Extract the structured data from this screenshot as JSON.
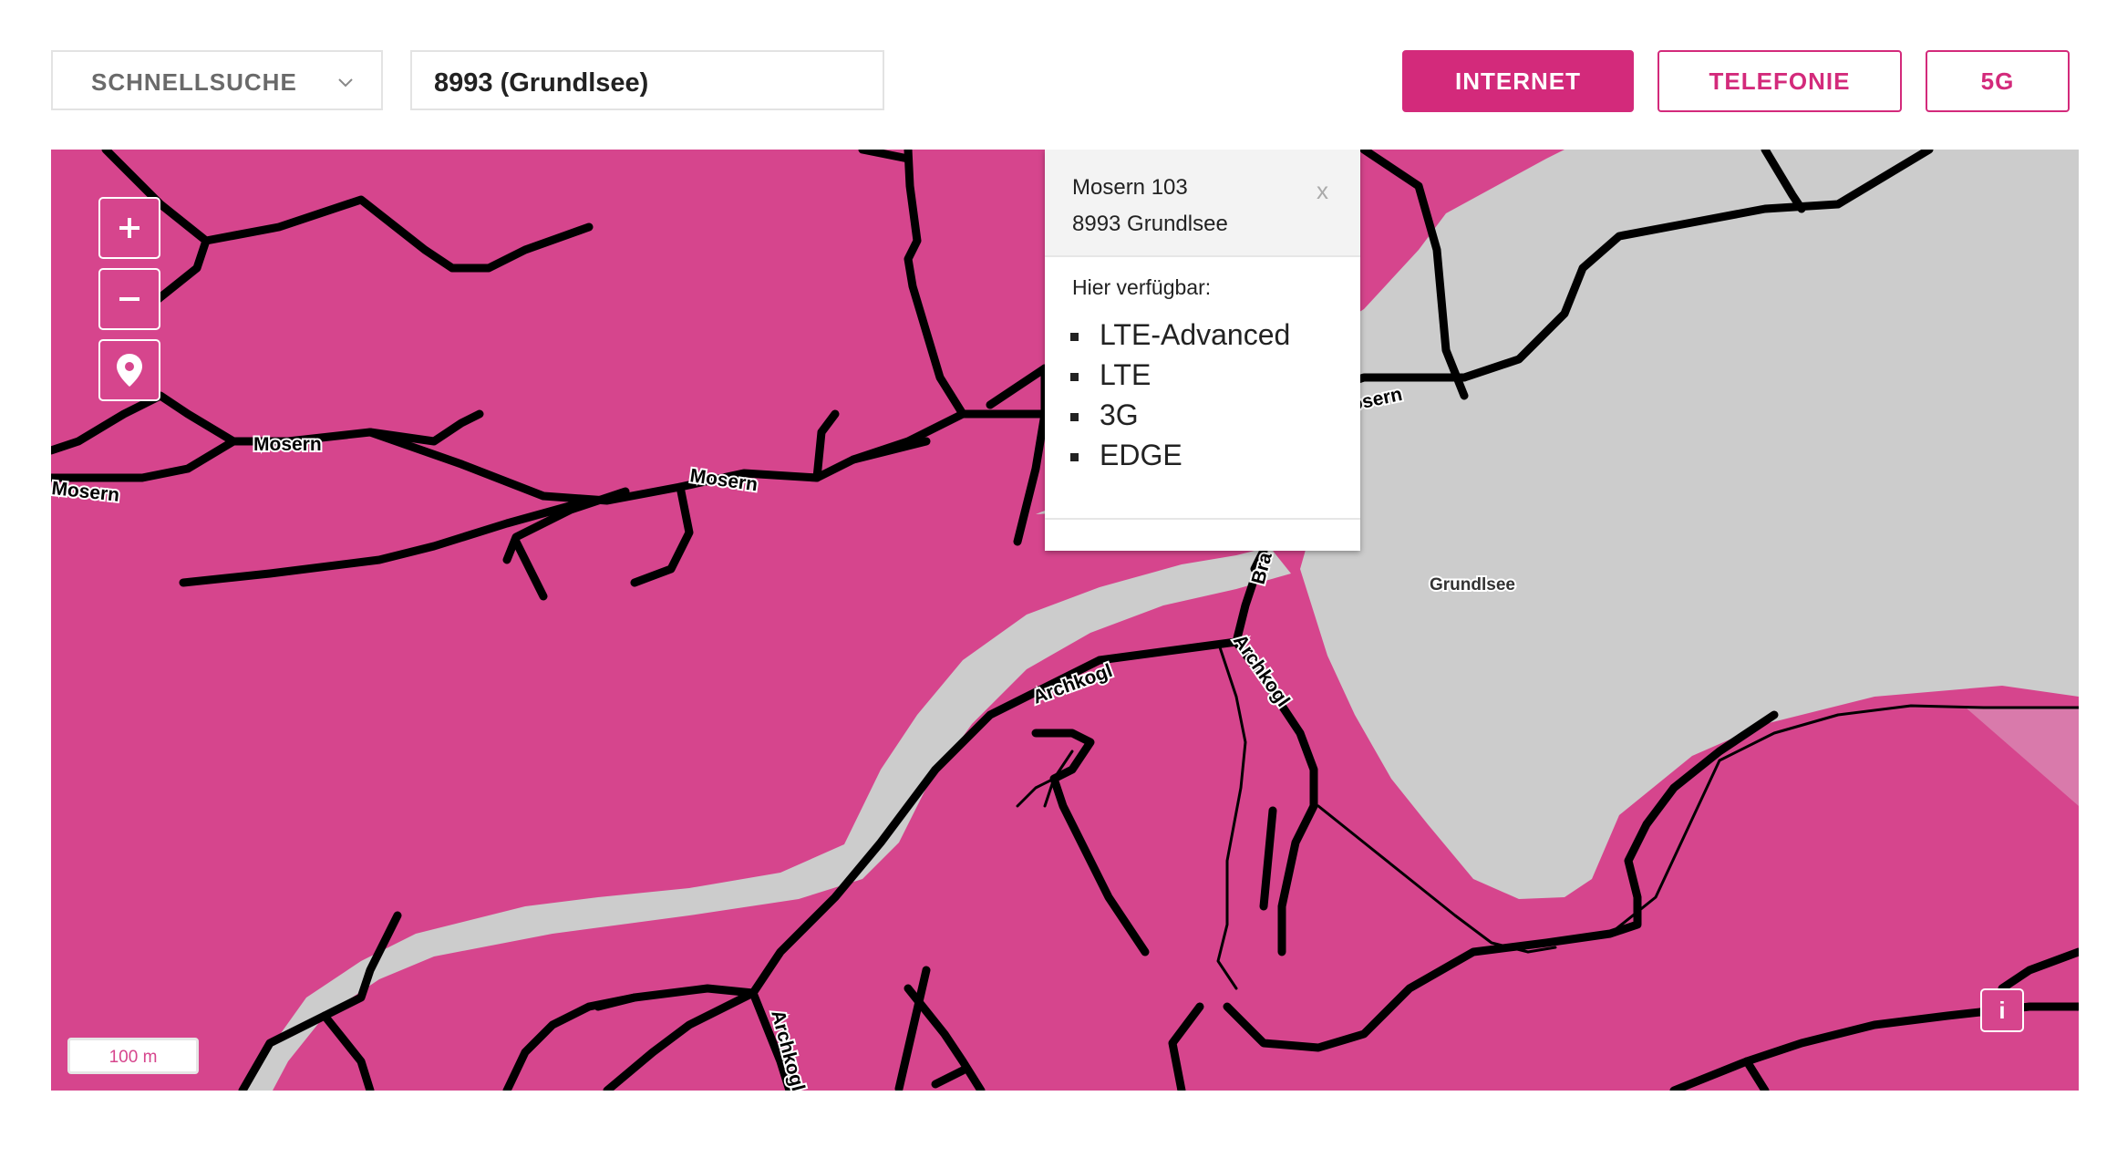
{
  "search": {
    "quick_search_label": "SCHNELLSUCHE",
    "location_value": "8993 (Grundlsee)"
  },
  "tabs": [
    {
      "label": "INTERNET",
      "active": true
    },
    {
      "label": "TELEFONIE",
      "active": false
    },
    {
      "label": "5G",
      "active": false
    }
  ],
  "map": {
    "coverage_color": "#d6458d",
    "water_color": "#cccccc",
    "road_color": "#000000",
    "road_labels": [
      "Mosern",
      "Mosern",
      "Mosern",
      "Mosern",
      "Archkogl",
      "Archkogl",
      "Archkogl",
      "Bra"
    ],
    "lake_label": "Grundlsee",
    "scale_label": "100 m",
    "info_button_label": "i",
    "controls": [
      "zoom-in-icon",
      "zoom-out-icon",
      "location-pin-icon"
    ]
  },
  "popup": {
    "address_line1": "Mosern 103",
    "address_line2": "8993 Grundlsee",
    "close_label": "x",
    "available_label": "Hier verfügbar:",
    "technologies": [
      "LTE-Advanced",
      "LTE",
      "3G",
      "EDGE"
    ]
  }
}
